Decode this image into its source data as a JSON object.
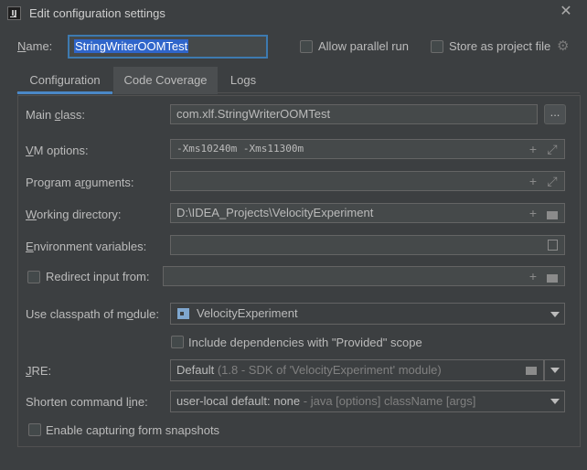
{
  "window": {
    "title": "Edit configuration settings",
    "app_icon": "IJ",
    "close_icon": "✕"
  },
  "header": {
    "name_label": "Name:",
    "name_value": "StringWriterOOMTest",
    "allow_parallel_label": "Allow parallel run",
    "store_as_file_label": "Store as project file"
  },
  "tabs": [
    {
      "label": "Configuration",
      "state": "active"
    },
    {
      "label": "Code Coverage",
      "state": "hover"
    },
    {
      "label": "Logs",
      "state": "normal"
    }
  ],
  "form": {
    "main_class": {
      "label": "Main class:",
      "value": "com.xlf.StringWriterOOMTest",
      "button": "..."
    },
    "vm_options": {
      "label": "VM options:",
      "value": "-Xms10240m -Xms11300m"
    },
    "program_args": {
      "label": "Program arguments:",
      "value": ""
    },
    "working_dir": {
      "label": "Working directory:",
      "value": "D:\\IDEA_Projects\\VelocityExperiment"
    },
    "env_vars": {
      "label": "Environment variables:",
      "value": ""
    },
    "redirect_input": {
      "label": "Redirect input from:",
      "checked": false,
      "value": ""
    },
    "classpath_module": {
      "label": "Use classpath of module:",
      "value": "VelocityExperiment"
    },
    "include_provided": {
      "label": "Include dependencies with \"Provided\" scope",
      "checked": false
    },
    "jre": {
      "label": "JRE:",
      "value": "Default",
      "hint": "(1.8 - SDK of 'VelocityExperiment' module)"
    },
    "shorten_cmd": {
      "label": "Shorten command line:",
      "value": "user-local default: none",
      "hint": "- java [options] className [args]"
    },
    "capture_snapshots": {
      "label": "Enable capturing form snapshots",
      "checked": false
    }
  },
  "icons": {
    "add": "+",
    "expand": "⤢",
    "folder": "folder-icon",
    "list": "list-icon",
    "gear": "⚙"
  },
  "colors": {
    "background": "#3c3f41",
    "field": "#45494a",
    "selection": "#2f65ca",
    "accent": "#4a88c7"
  }
}
